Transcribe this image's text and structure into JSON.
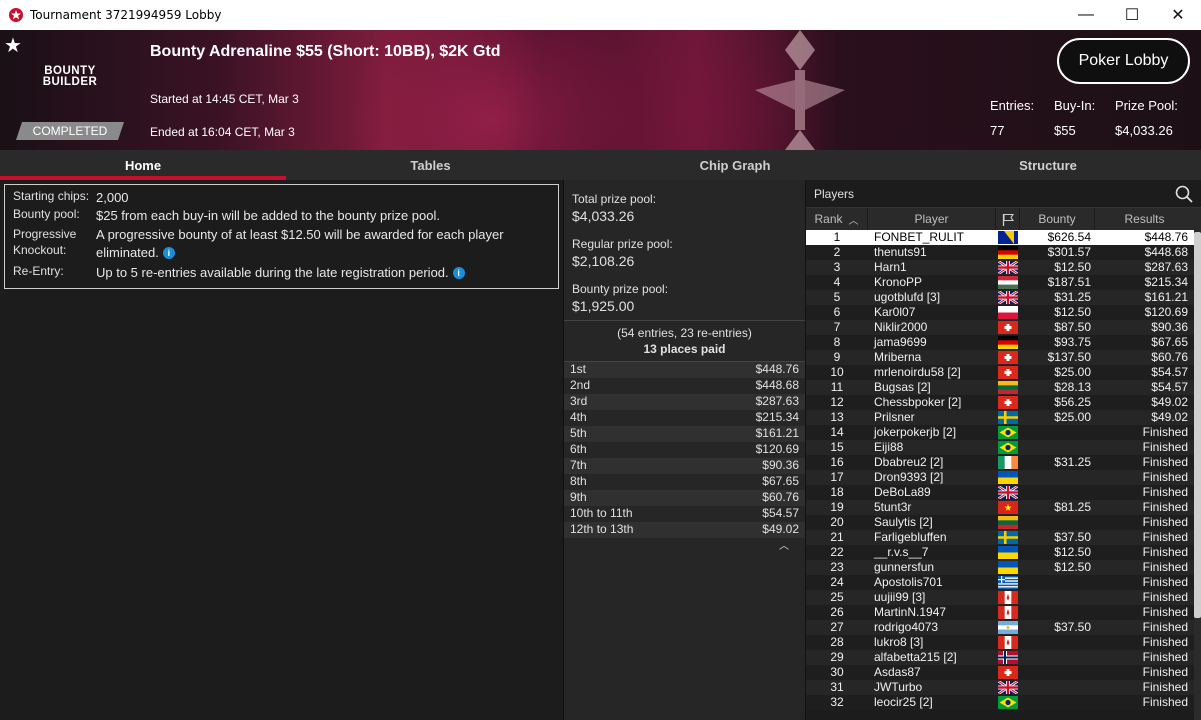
{
  "window": {
    "title": "Tournament 3721994959 Lobby",
    "minimize": "—",
    "maximize": "☐",
    "close": "✕"
  },
  "header": {
    "logo_line1": "BOUNTY",
    "logo_line2": "BUILDER",
    "status_badge": "COMPLETED",
    "title": "Bounty Adrenaline $55 (Short: 10BB), $2K Gtd",
    "started": "Started at 14:45 CET, Mar 3",
    "ended": "Ended at 16:04 CET, Mar 3",
    "lobby_button": "Poker Lobby",
    "entries_label": "Entries:",
    "entries_value": "77",
    "buyin_label": "Buy-In:",
    "buyin_value": "$55",
    "prizepool_label": "Prize Pool:",
    "prizepool_value": "$4,033.26"
  },
  "tabs": [
    {
      "label": "Home",
      "active": true
    },
    {
      "label": "Tables",
      "active": false
    },
    {
      "label": "Chip Graph",
      "active": false
    },
    {
      "label": "Structure",
      "active": false
    }
  ],
  "info": {
    "starting_chips_label": "Starting chips:",
    "starting_chips_value": "2,000",
    "bounty_pool_label": "Bounty pool:",
    "bounty_pool_value": "$25 from each buy-in will be added to the bounty prize pool.",
    "progressive_label": "Progressive Knockout:",
    "progressive_value": "A progressive bounty of at least $12.50 will be awarded for each player eliminated.",
    "reentry_label": "Re-Entry:",
    "reentry_value": "Up to 5 re-entries available during the late registration period."
  },
  "prizes": {
    "total_label": "Total prize pool:",
    "total_value": "$4,033.26",
    "regular_label": "Regular prize pool:",
    "regular_value": "$2,108.26",
    "bounty_label": "Bounty prize pool:",
    "bounty_value": "$1,925.00",
    "entries_note": "(54 entries, 23 re-entries)",
    "places_paid": "13 places paid",
    "payouts": [
      {
        "place": "1st",
        "amount": "$448.76"
      },
      {
        "place": "2nd",
        "amount": "$448.68"
      },
      {
        "place": "3rd",
        "amount": "$287.63"
      },
      {
        "place": "4th",
        "amount": "$215.34"
      },
      {
        "place": "5th",
        "amount": "$161.21"
      },
      {
        "place": "6th",
        "amount": "$120.69"
      },
      {
        "place": "7th",
        "amount": "$90.36"
      },
      {
        "place": "8th",
        "amount": "$67.65"
      },
      {
        "place": "9th",
        "amount": "$60.76"
      },
      {
        "place": "10th to 11th",
        "amount": "$54.57"
      },
      {
        "place": "12th to 13th",
        "amount": "$49.02"
      }
    ]
  },
  "players_panel": {
    "title": "Players",
    "col_rank": "Rank",
    "col_player": "Player",
    "col_bounty": "Bounty",
    "col_results": "Results",
    "rows": [
      {
        "rank": "1",
        "name": "FONBET_RULIT",
        "flag": "bih",
        "bounty": "$626.54",
        "result": "$448.76"
      },
      {
        "rank": "2",
        "name": "thenuts91",
        "flag": "de",
        "bounty": "$301.57",
        "result": "$448.68"
      },
      {
        "rank": "3",
        "name": "Harn1",
        "flag": "gb",
        "bounty": "$12.50",
        "result": "$287.63"
      },
      {
        "rank": "4",
        "name": "KronoPP",
        "flag": "hu",
        "bounty": "$187.51",
        "result": "$215.34"
      },
      {
        "rank": "5",
        "name": "ugotblufd [3]",
        "flag": "gb",
        "bounty": "$31.25",
        "result": "$161.21"
      },
      {
        "rank": "6",
        "name": "Kar0l07",
        "flag": "pl",
        "bounty": "$12.50",
        "result": "$120.69"
      },
      {
        "rank": "7",
        "name": "Niklir2000",
        "flag": "ch",
        "bounty": "$87.50",
        "result": "$90.36"
      },
      {
        "rank": "8",
        "name": "jama9699",
        "flag": "de",
        "bounty": "$93.75",
        "result": "$67.65"
      },
      {
        "rank": "9",
        "name": "Mriberna",
        "flag": "ch",
        "bounty": "$137.50",
        "result": "$60.76"
      },
      {
        "rank": "10",
        "name": "mrlenoirdu58 [2]",
        "flag": "ch",
        "bounty": "$25.00",
        "result": "$54.57"
      },
      {
        "rank": "11",
        "name": "Bugsas [2]",
        "flag": "lt",
        "bounty": "$28.13",
        "result": "$54.57"
      },
      {
        "rank": "12",
        "name": "Chessbpoker [2]",
        "flag": "ch",
        "bounty": "$56.25",
        "result": "$49.02"
      },
      {
        "rank": "13",
        "name": "Prilsner",
        "flag": "se",
        "bounty": "$25.00",
        "result": "$49.02"
      },
      {
        "rank": "14",
        "name": "jokerpokerjb [2]",
        "flag": "br",
        "bounty": "",
        "result": "Finished"
      },
      {
        "rank": "15",
        "name": "Eiji88",
        "flag": "br",
        "bounty": "",
        "result": "Finished"
      },
      {
        "rank": "16",
        "name": "Dbabreu2 [2]",
        "flag": "ie",
        "bounty": "$31.25",
        "result": "Finished"
      },
      {
        "rank": "17",
        "name": "Dron9393 [2]",
        "flag": "ua",
        "bounty": "",
        "result": "Finished"
      },
      {
        "rank": "18",
        "name": "DeBoLa89",
        "flag": "gb",
        "bounty": "",
        "result": "Finished"
      },
      {
        "rank": "19",
        "name": "5tunt3r",
        "flag": "vn",
        "bounty": "$81.25",
        "result": "Finished"
      },
      {
        "rank": "20",
        "name": "Saulytis [2]",
        "flag": "lt",
        "bounty": "",
        "result": "Finished"
      },
      {
        "rank": "21",
        "name": "Farligebluffen",
        "flag": "se",
        "bounty": "$37.50",
        "result": "Finished"
      },
      {
        "rank": "22",
        "name": "__r.v.s__7",
        "flag": "ua",
        "bounty": "$12.50",
        "result": "Finished"
      },
      {
        "rank": "23",
        "name": "gunnersfun",
        "flag": "ua",
        "bounty": "$12.50",
        "result": "Finished"
      },
      {
        "rank": "24",
        "name": "Apostolis701",
        "flag": "gr",
        "bounty": "",
        "result": "Finished"
      },
      {
        "rank": "25",
        "name": "uujii99 [3]",
        "flag": "ca",
        "bounty": "",
        "result": "Finished"
      },
      {
        "rank": "26",
        "name": "MartinN.1947",
        "flag": "ca",
        "bounty": "",
        "result": "Finished"
      },
      {
        "rank": "27",
        "name": "rodrigo4073",
        "flag": "ar",
        "bounty": "$37.50",
        "result": "Finished"
      },
      {
        "rank": "28",
        "name": "lukro8 [3]",
        "flag": "ca",
        "bounty": "",
        "result": "Finished"
      },
      {
        "rank": "29",
        "name": "alfabetta215 [2]",
        "flag": "no",
        "bounty": "",
        "result": "Finished"
      },
      {
        "rank": "30",
        "name": "Asdas87",
        "flag": "ch",
        "bounty": "",
        "result": "Finished"
      },
      {
        "rank": "31",
        "name": "JWTurbo",
        "flag": "gb",
        "bounty": "",
        "result": "Finished"
      },
      {
        "rank": "32",
        "name": "leocir25 [2]",
        "flag": "br",
        "bounty": "",
        "result": "Finished"
      }
    ]
  },
  "colors": {
    "accent": "#c8102e",
    "info_icon": "#1b8ed8"
  }
}
